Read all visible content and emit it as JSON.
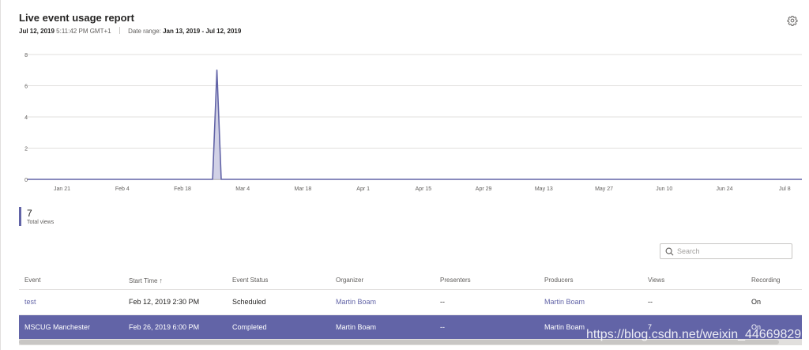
{
  "report": {
    "title": "Live event usage report",
    "timestamp_date": "Jul 12, 2019",
    "timestamp_time": "5:11:42 PM GMT+1",
    "date_range_label": "Date range:",
    "date_range_value": "Jan 13, 2019 - Jul 12, 2019"
  },
  "icons": {
    "settings": "gear-icon",
    "search": "search-icon",
    "sort": "sort-up-arrow"
  },
  "colors": {
    "accent": "#6264a7",
    "area_fill": "#c5c6e0",
    "grid": "#e1dfdd"
  },
  "chart_data": {
    "type": "area",
    "title": "",
    "xlabel": "",
    "ylabel": "",
    "ylim": [
      0,
      8
    ],
    "yticks": [
      0,
      2,
      4,
      6,
      8
    ],
    "x_tick_labels": [
      "Jan 21",
      "Feb 4",
      "Feb 18",
      "Mar 4",
      "Mar 18",
      "Apr 1",
      "Apr 15",
      "Apr 29",
      "May 13",
      "May 27",
      "Jun 10",
      "Jun 24",
      "Jul 8"
    ],
    "x_tick_dates": [
      "2019-01-21",
      "2019-02-04",
      "2019-02-18",
      "2019-03-04",
      "2019-03-18",
      "2019-04-01",
      "2019-04-15",
      "2019-04-29",
      "2019-05-13",
      "2019-05-27",
      "2019-06-10",
      "2019-06-24",
      "2019-07-08"
    ],
    "x_range": [
      "2019-01-13",
      "2019-07-12"
    ],
    "grid": true,
    "series": [
      {
        "points": [
          {
            "x": "2019-01-13",
            "y": 0
          },
          {
            "x": "2019-02-25",
            "y": 0
          },
          {
            "x": "2019-02-26",
            "y": 7
          },
          {
            "x": "2019-02-27",
            "y": 0
          },
          {
            "x": "2019-07-12",
            "y": 0
          }
        ]
      }
    ]
  },
  "kpi": {
    "value": "7",
    "label": "Total views"
  },
  "search": {
    "placeholder": "Search",
    "value": ""
  },
  "table": {
    "columns": [
      {
        "key": "event",
        "label": "Event"
      },
      {
        "key": "start_time",
        "label": "Start Time",
        "sort": "↑"
      },
      {
        "key": "status",
        "label": "Event Status"
      },
      {
        "key": "organizer",
        "label": "Organizer"
      },
      {
        "key": "presenters",
        "label": "Presenters"
      },
      {
        "key": "producers",
        "label": "Producers"
      },
      {
        "key": "views",
        "label": "Views"
      },
      {
        "key": "recording",
        "label": "Recording"
      }
    ],
    "rows": [
      {
        "event": "test",
        "start_time": "Feb 12, 2019 2:30 PM",
        "status": "Scheduled",
        "organizer": "Martin Boam",
        "presenters": "--",
        "producers": "Martin Boam",
        "views": "--",
        "recording": "On"
      },
      {
        "event": "MSCUG Manchester",
        "start_time": "Feb 26, 2019 6:00 PM",
        "status": "Completed",
        "organizer": "Martin Boam",
        "presenters": "--",
        "producers": "Martin Boam",
        "views": "7",
        "recording": "On"
      }
    ]
  },
  "watermark": "https://blog.csdn.net/weixin_44669829"
}
